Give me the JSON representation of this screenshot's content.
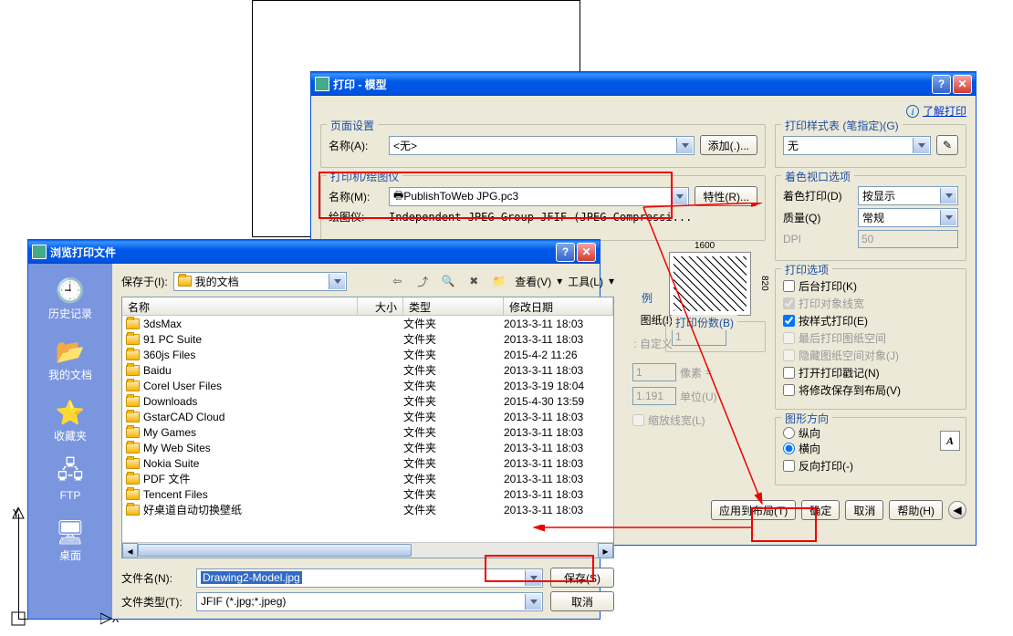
{
  "bg": {
    "y_label": "Y",
    "x_label": "X"
  },
  "print": {
    "title": "打印 - 模型",
    "help_link": "了解打印",
    "page_setup": {
      "legend": "页面设置",
      "name_label": "名称(A):",
      "name_value": "<无>",
      "add_btn": "添加(.)..."
    },
    "printer": {
      "legend": "打印机/绘图仪",
      "name_label": "名称(M):",
      "name_value": "PublishToWeb JPG.pc3",
      "props_btn": "特性(R)...",
      "plotter_label": "绘图仪:",
      "plotter_value": "Independent JPEG Group JFIF (JPEG Compressi...",
      "dim_w": "1600",
      "dim_h": "820"
    },
    "copies": {
      "legend": "打印份数(B)",
      "value": "1"
    },
    "styles": {
      "legend": "打印样式表 (笔指定)(G)",
      "value": "无"
    },
    "shade": {
      "legend": "着色视口选项",
      "mode_label": "着色打印(D)",
      "mode_value": "按显示",
      "quality_label": "质量(Q)",
      "quality_value": "常规",
      "dpi_label": "DPI",
      "dpi_value": "50"
    },
    "options": {
      "legend": "打印选项",
      "bg": "后台打印(K)",
      "lw": "打印对象线宽",
      "bystyle": "按样式打印(E)",
      "paperspace": "最后打印图纸空间",
      "hide": "隐藏图纸空间对象(J)",
      "stamp": "打开打印戳记(N)",
      "save": "将修改保存到布局(V)"
    },
    "orientation": {
      "legend": "图形方向",
      "portrait": "纵向",
      "landscape": "横向",
      "reverse": "反向打印(-)"
    },
    "frag_example": "例",
    "frag_paper": "图纸(I)",
    "frag_custom": ":       自定义",
    "frag_scale1": "1",
    "frag_pixel": "像素",
    "frag_eq": "=",
    "frag_scale2": "1.191",
    "frag_unit": "单位(U)",
    "frag_scalelw": "缩放线宽(L)",
    "footer": {
      "apply": "应用到布局(T)",
      "ok": "确定",
      "cancel": "取消",
      "help": "帮助(H)"
    }
  },
  "browse": {
    "title": "浏览打印文件",
    "save_in_label": "保存于(I):",
    "save_in_value": "我的文档",
    "view": "查看(V)",
    "tools": "工具(L)",
    "sidebar": {
      "history": "历史记录",
      "docs": "我的文档",
      "fav": "收藏夹",
      "ftp": "FTP",
      "desktop": "桌面"
    },
    "cols": {
      "name": "名称",
      "size": "大小",
      "type": "类型",
      "date": "修改日期"
    },
    "folder_type": "文件夹",
    "rows": [
      {
        "n": "3dsMax",
        "d": "2013-3-11 18:03"
      },
      {
        "n": "91 PC Suite",
        "d": "2013-3-11 18:03"
      },
      {
        "n": "360js Files",
        "d": "2015-4-2 11:26"
      },
      {
        "n": "Baidu",
        "d": "2013-3-11 18:03"
      },
      {
        "n": "Corel User Files",
        "d": "2013-3-19 18:04"
      },
      {
        "n": "Downloads",
        "d": "2015-4-30 13:59"
      },
      {
        "n": "GstarCAD Cloud",
        "d": "2013-3-11 18:03"
      },
      {
        "n": "My Games",
        "d": "2013-3-11 18:03"
      },
      {
        "n": "My Web Sites",
        "d": "2013-3-11 18:03"
      },
      {
        "n": "Nokia Suite",
        "d": "2013-3-11 18:03"
      },
      {
        "n": "PDF 文件",
        "d": "2013-3-11 18:03"
      },
      {
        "n": "Tencent Files",
        "d": "2013-3-11 18:03"
      },
      {
        "n": "好桌道自动切换壁纸",
        "d": "2013-3-11 18:03"
      }
    ],
    "file_name_label": "文件名(N):",
    "file_name_value": "Drawing2-Model.jpg",
    "file_type_label": "文件类型(T):",
    "file_type_value": "JFIF (*.jpg;*.jpeg)",
    "save_btn": "保存(S)",
    "cancel_btn": "取消"
  }
}
